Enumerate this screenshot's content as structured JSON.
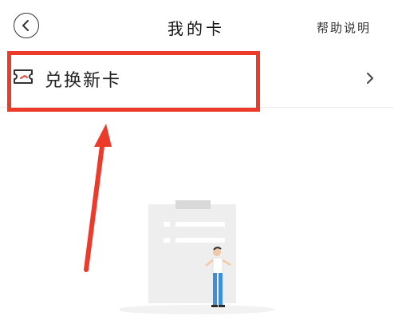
{
  "header": {
    "title": "我的卡",
    "help_label": "帮助说明",
    "back_icon": "chevron-left-icon"
  },
  "redeem_row": {
    "label": "兑换新卡",
    "leading_icon": "ticket-icon",
    "trailing_icon": "chevron-right-icon"
  },
  "annotation": {
    "color": "#ec3a2b"
  },
  "empty_state": {
    "illustration": "empty-clipboard-person"
  }
}
